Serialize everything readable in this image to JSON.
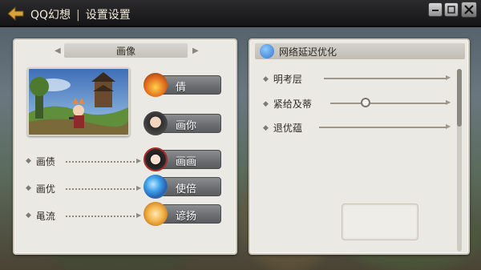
{
  "titlebar": {
    "app_name": "QQ幻想",
    "separator": "|",
    "page_title": "设置设置",
    "back_icon": "back-arrow-icon",
    "window_controls": [
      "minimize-icon",
      "restore-icon",
      "close-icon"
    ]
  },
  "left_panel": {
    "tab_label": "画像",
    "tab_prev_icon": "chevron-left-icon",
    "tab_next_icon": "chevron-right-icon",
    "buttons": [
      {
        "label": "倩",
        "icon": "fire-portrait-icon"
      },
      {
        "label": "画你",
        "icon": "character-portrait-icon"
      },
      {
        "label": "画画",
        "icon": "girl-portrait-icon"
      },
      {
        "label": "使倍",
        "icon": "orb-icon"
      },
      {
        "label": "谚扬",
        "icon": "fox-icon"
      }
    ],
    "settings": [
      {
        "label": "画债"
      },
      {
        "label": "画优"
      },
      {
        "label": "黾流"
      }
    ]
  },
  "right_panel": {
    "title": "网络延迟优化",
    "title_icon": "network-icon",
    "rows": [
      {
        "label": "明考层",
        "control": "line"
      },
      {
        "label": "紧给及蒂",
        "control": "slider",
        "value": 0.3
      },
      {
        "label": "退优蕴",
        "control": "line"
      }
    ]
  },
  "colors": {
    "panel_bg": "#ebe9e4",
    "button_bg": "#6d6f72",
    "titlebar_bg": "#1e1e20",
    "accent_blue": "#2f78c8"
  }
}
